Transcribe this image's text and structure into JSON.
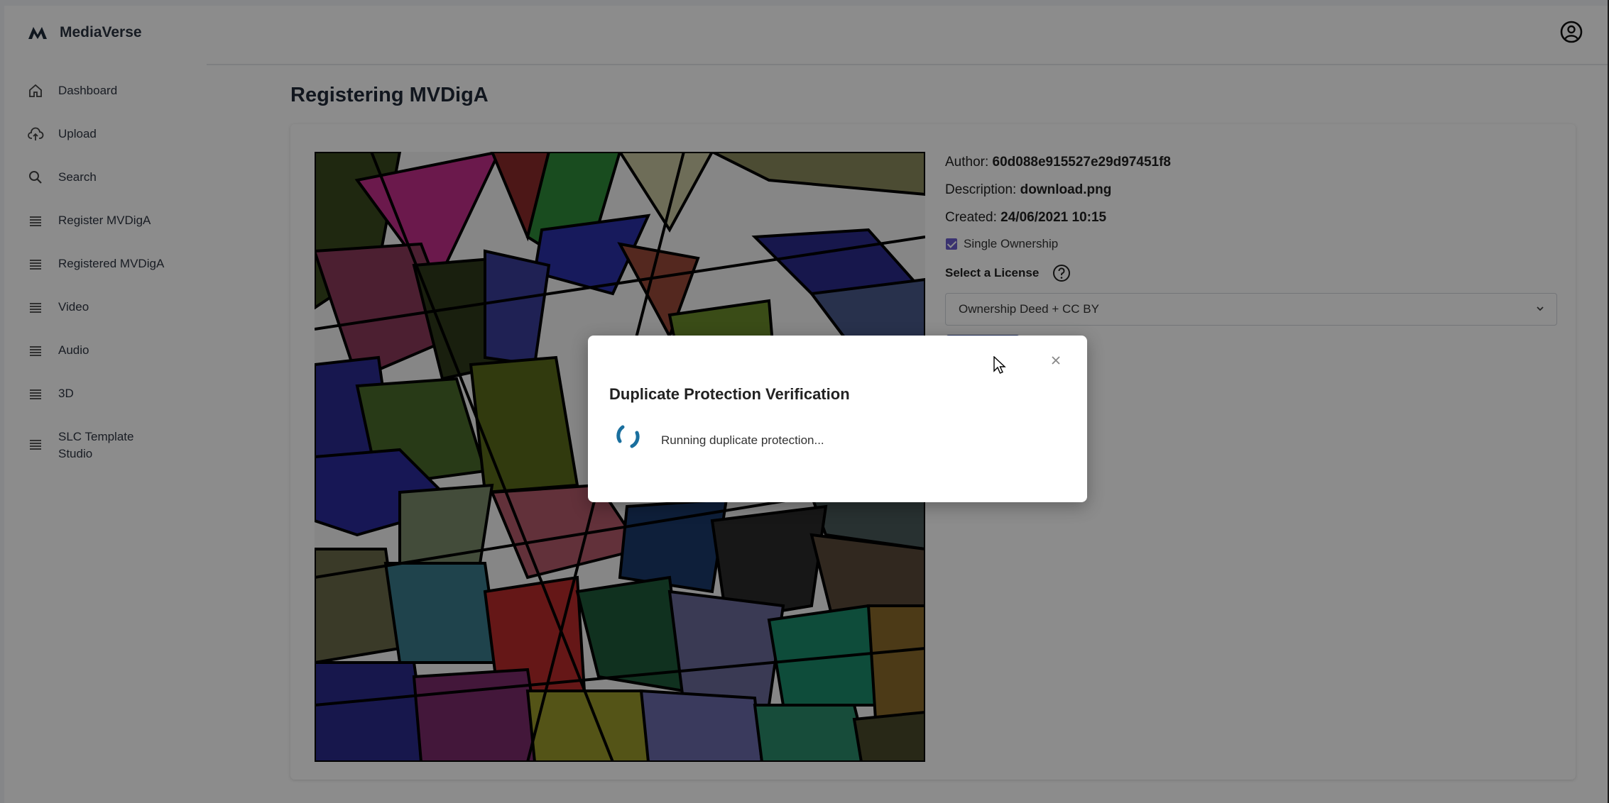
{
  "app": {
    "name": "MediaVerse"
  },
  "sidebar": {
    "items": [
      {
        "label": "Dashboard",
        "icon": "home-icon"
      },
      {
        "label": "Upload",
        "icon": "cloud-upload-icon"
      },
      {
        "label": "Search",
        "icon": "search-icon"
      },
      {
        "label": "Register MVDigA",
        "icon": "list-icon"
      },
      {
        "label": "Registered MVDigA",
        "icon": "list-icon"
      },
      {
        "label": "Video",
        "icon": "list-icon"
      },
      {
        "label": "Audio",
        "icon": "list-icon"
      },
      {
        "label": "3D",
        "icon": "list-icon"
      },
      {
        "label": "SLC Template Studio",
        "icon": "list-icon"
      }
    ]
  },
  "page": {
    "title": "Registering MVDigA"
  },
  "details": {
    "author_label": "Author:",
    "author_value": "60d088e915527e29d97451f8",
    "description_label": "Description:",
    "description_value": "download.png",
    "created_label": "Created:",
    "created_value": "24/06/2021 10:15",
    "ownership_label": "Single Ownership",
    "ownership_checked": true,
    "license_label": "Select a License",
    "license_value": "Ownership Deed + CC BY"
  },
  "modal": {
    "title": "Duplicate Protection Verification",
    "status": "Running duplicate protection..."
  },
  "colors": {
    "accent": "#6b5ccc",
    "primary": "#1f3a8a",
    "spinner": "#1a6f9e",
    "overlay": "rgba(0,0,0,0.45)"
  }
}
